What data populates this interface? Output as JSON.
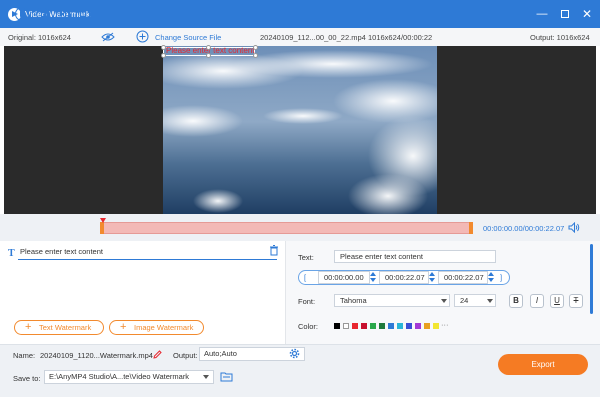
{
  "window": {
    "title": "Video Watermark",
    "accent": "#2e7ad6",
    "export_color": "#f57b23"
  },
  "infobar": {
    "original": "Original: 1016x624",
    "change_source": "Change Source File",
    "file_name": "20240109_112...00_00_22.mp4",
    "file_info": "1016x624/00:00:22",
    "output": "Output: 1016x624"
  },
  "preview": {
    "watermark_text": "Please enter text content",
    "watermark_color": "#e8272f"
  },
  "controls": {
    "timecode": "00:00:00.00/00:00:22.07"
  },
  "left_panel": {
    "item_text": "Please enter text content",
    "text_watermark_label": "Text Watermark",
    "image_watermark_label": "Image Watermark"
  },
  "right_panel": {
    "text_label": "Text:",
    "text_placeholder": "Please enter text content",
    "start_time": "00:00:00.00",
    "end_time": "00:00:22.07",
    "duration": "00:00:22.07",
    "font_label": "Font:",
    "font_name": "Tahoma",
    "font_size": "24",
    "bold": "B",
    "italic": "I",
    "underline": "U",
    "strike": "T",
    "color_label": "Color:",
    "colors": [
      "#000000",
      "#ffffff",
      "#e8272f",
      "#c8102e",
      "#2aa84a",
      "#1f7a3c",
      "#2e7ad6",
      "#29b6d8",
      "#3a4ed6",
      "#a43ad6",
      "#e8a020",
      "#f2e632"
    ],
    "more_colors": "···"
  },
  "bottom": {
    "name_label": "Name:",
    "name_value": "20240109_1120...Watermark.mp4",
    "output_label": "Output:",
    "output_value": "Auto;Auto",
    "save_label": "Save to:",
    "save_path": "E:\\AnyMP4 Studio\\A...te\\Video Watermark",
    "export_label": "Export"
  }
}
